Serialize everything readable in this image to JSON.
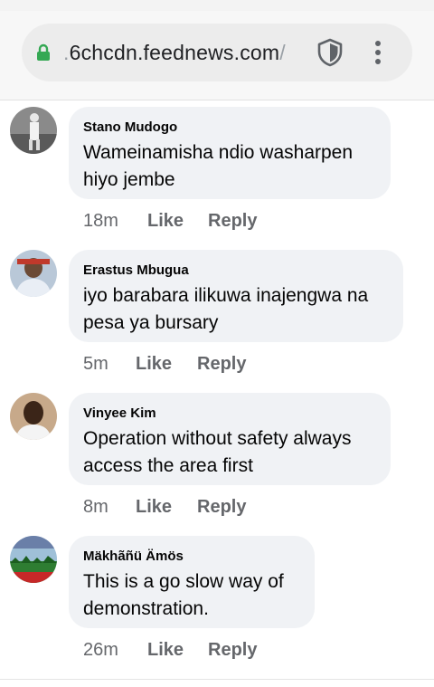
{
  "browser": {
    "url_prefix": ".",
    "url_main": "6chcdn.feednews.com",
    "url_suffix": "/",
    "secure_icon": "lock-icon",
    "shield_icon": "shield-icon",
    "menu_icon": "more-vert-icon",
    "accent_color": "#34a853"
  },
  "comments": [
    {
      "author": "Stano Mudogo",
      "text": "Wameinamisha ndio washarpen\nhiyo jembe",
      "time": "18m",
      "like_label": "Like",
      "reply_label": "Reply"
    },
    {
      "author": "Erastus Mbugua",
      "text": "iyo barabara ilikuwa inajengwa na\npesa ya bursary",
      "time": "5m",
      "like_label": "Like",
      "reply_label": "Reply"
    },
    {
      "author": "Vinyee Kim",
      "text": "Operation without safety always\naccess the area first",
      "time": "8m",
      "like_label": "Like",
      "reply_label": "Reply"
    },
    {
      "author": "Mäkhãñü Ämös",
      "text": "This is a go slow way of\ndemonstration.",
      "time": "26m",
      "like_label": "Like",
      "reply_label": "Reply"
    }
  ]
}
